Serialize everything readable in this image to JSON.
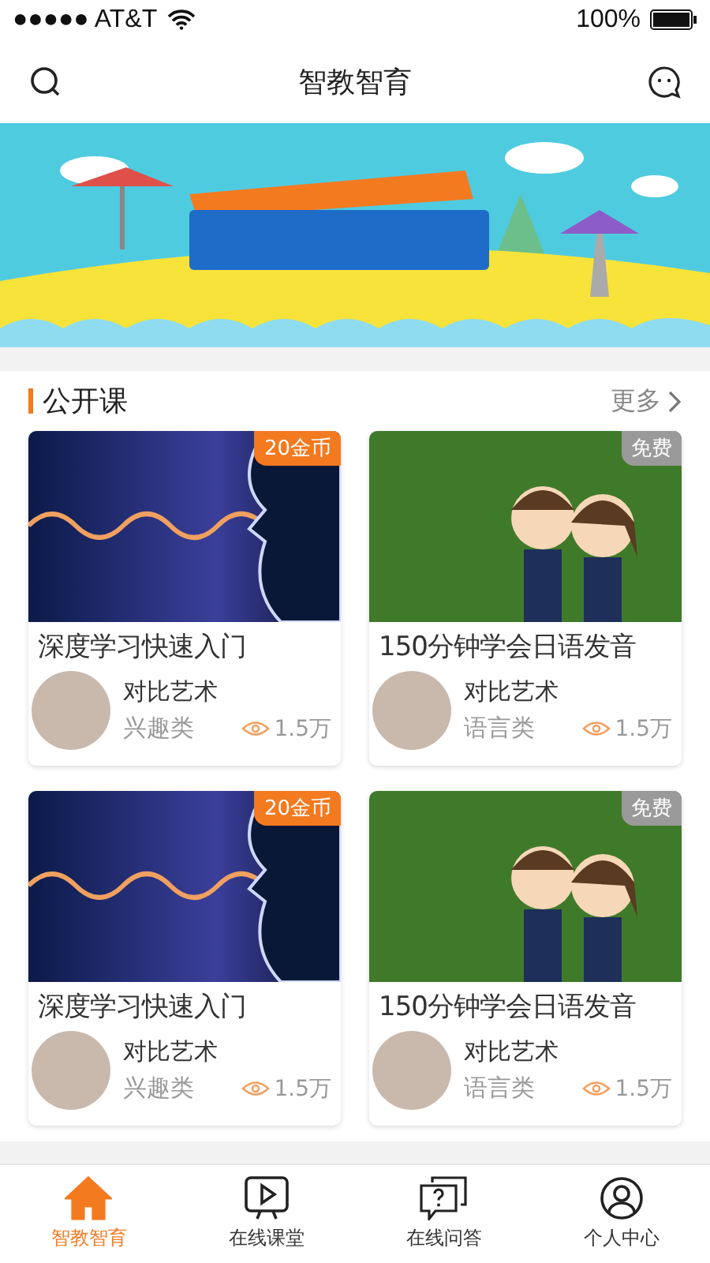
{
  "status_bar": {
    "carrier": "●●●●● AT&T",
    "battery": "100%"
  },
  "nav": {
    "title": "智教智育"
  },
  "section": {
    "title": "公开课",
    "more": "更多"
  },
  "courses": [
    {
      "kind": "sound",
      "badge": {
        "kind": "paid",
        "text": "20金币"
      },
      "title": "深度学习快速入门",
      "author": "对比艺术",
      "category": "兴趣类",
      "views": "1.5万"
    },
    {
      "kind": "chalkboard",
      "badge": {
        "kind": "free",
        "text": "免费"
      },
      "title": "150分钟学会日语发音",
      "author": "对比艺术",
      "category": "语言类",
      "views": "1.5万"
    },
    {
      "kind": "sound",
      "badge": {
        "kind": "paid",
        "text": "20金币"
      },
      "title": "深度学习快速入门",
      "author": "对比艺术",
      "category": "兴趣类",
      "views": "1.5万"
    },
    {
      "kind": "chalkboard",
      "badge": {
        "kind": "free",
        "text": "免费"
      },
      "title": "150分钟学会日语发音",
      "author": "对比艺术",
      "category": "语言类",
      "views": "1.5万"
    }
  ],
  "tabs": [
    {
      "kind": "home",
      "label": "智教智育",
      "selected": true
    },
    {
      "kind": "play",
      "label": "在线课堂",
      "selected": false
    },
    {
      "kind": "question",
      "label": "在线问答",
      "selected": false
    },
    {
      "kind": "person",
      "label": "个人中心",
      "selected": false
    }
  ]
}
